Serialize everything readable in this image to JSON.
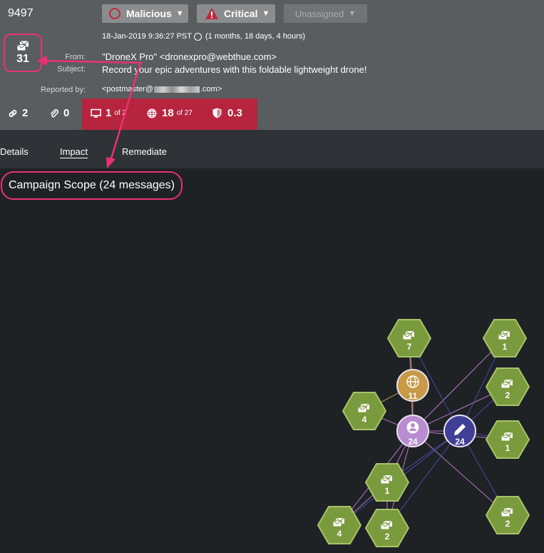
{
  "header": {
    "incident_id": "9497",
    "status": {
      "label": "Malicious"
    },
    "severity": {
      "label": "Critical"
    },
    "assignee": {
      "label": "Unassigned"
    },
    "message_count": "31",
    "date": "18-Jan-2019 9:36:27 PST",
    "age": "(1 months, 18 days, 4 hours)",
    "from_label": "From:",
    "from_value": "\"DroneX Pro\" <dronexpro@webthue.com>",
    "subject_label": "Subject:",
    "subject_value": "Record your epic adventures with this foldable lightweight drone!",
    "reported_label": "Reported by:",
    "reported_prefix": "<postmaster@",
    "reported_suffix": ".com>"
  },
  "counters": {
    "links": "2",
    "attachments": "0",
    "hosts": "1",
    "hosts_of": "of 2",
    "urls": "18",
    "urls_of": "of 27",
    "score": "0.3"
  },
  "tabs": [
    {
      "label": "Details"
    },
    {
      "label": "Impact"
    },
    {
      "label": "Remediate"
    }
  ],
  "campaign_scope": "Campaign Scope (24 messages)",
  "graph": {
    "colors": {
      "hex": "#7a9a3e",
      "user": "#b98bd0",
      "url": "#c89a48",
      "sender": "#3f3f96",
      "edge_light": "#c07ad0",
      "edge_dark": "#4a4aa8"
    },
    "nodes": [
      {
        "id": "user",
        "kind": "user",
        "count": "24"
      },
      {
        "id": "sender",
        "kind": "sender",
        "count": "24"
      },
      {
        "id": "url",
        "kind": "url",
        "count": "11"
      },
      {
        "id": "m7",
        "kind": "message",
        "count": "7"
      },
      {
        "id": "m1a",
        "kind": "message",
        "count": "1"
      },
      {
        "id": "m2a",
        "kind": "message",
        "count": "2"
      },
      {
        "id": "m4a",
        "kind": "message",
        "count": "4"
      },
      {
        "id": "m1b",
        "kind": "message",
        "count": "1"
      },
      {
        "id": "m1c",
        "kind": "message",
        "count": "1"
      },
      {
        "id": "m4b",
        "kind": "message",
        "count": "4"
      },
      {
        "id": "m2b",
        "kind": "message",
        "count": "2"
      },
      {
        "id": "m2c",
        "kind": "message",
        "count": "2"
      }
    ]
  }
}
